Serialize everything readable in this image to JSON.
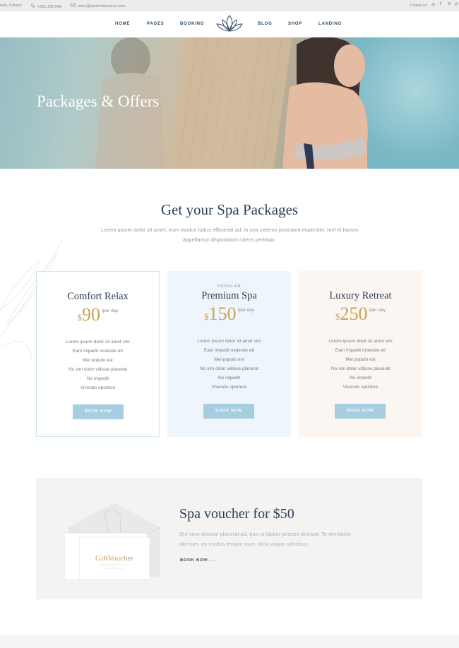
{
  "topbar": {
    "location": "avik, Iceland",
    "phone": "+351 258 548",
    "email": "reina@qodeinteractive.com",
    "follow_label": "Follow us:",
    "social_icons": [
      "instagram-icon",
      "facebook-icon",
      "pinterest-icon",
      "pinterest-icon"
    ],
    "social_glyphs": [
      "◎",
      "f",
      "℗",
      "p"
    ]
  },
  "nav": {
    "items": [
      "HOME",
      "PAGES",
      "BOOKING",
      "BLOG",
      "SHOP",
      "LANDING"
    ]
  },
  "hero": {
    "title": "Packages & Offers"
  },
  "packages": {
    "title": "Get your Spa Packages",
    "description": "Lorem ipsum dolor sit amet, eum modus ludus efficiendi ad, in sea ceteros postulant imperdiet, mel ei harum appellantur disputationi ridens pertinax.",
    "cards": [
      {
        "tag": "",
        "name": "Comfort Relax",
        "currency": "$",
        "amount": "90",
        "period": "/per day",
        "features": [
          "Lorem ipsum dolor sit amet vim",
          "Eam impedit molestie ett",
          "Mei populo est",
          "No vim dolor vidisse placerat",
          "No impedit",
          "Vivendo oportere"
        ],
        "button": "BOOK NOW"
      },
      {
        "tag": "POPULAR",
        "name": "Premium Spa",
        "currency": "$",
        "amount": "150",
        "period": "/per day",
        "features": [
          "Lorem ipsum dolor sit amet vim",
          "Eam impedit molestie ett",
          "Mei populo est",
          "No vim dolor vidisse placerat",
          "No impedit",
          "Vivendo oportere"
        ],
        "button": "BOOK NOW"
      },
      {
        "tag": "",
        "name": "Luxury Retreat",
        "currency": "$",
        "amount": "250",
        "period": "/per day",
        "features": [
          "Lorem ipsum dolor sit amet vim",
          "Eam impedit molestie ett",
          "Mei populo est",
          "No vim dolor vidisse placerat",
          "No impedit",
          "Vivendo oportere"
        ],
        "button": "BOOK NOW"
      }
    ]
  },
  "voucher": {
    "title": "Spa voucher for $50",
    "description": "Qui vero discere placerat ad, quo ut labitur percipit detraxit. Te vim latine alienum, eu modus tempor eum, dicta vitupe ratoribus.",
    "link": "BOOK NOW",
    "card_text": "GiftVoucher"
  },
  "colors": {
    "accent_gold": "#c9a25c",
    "button_blue": "#a7cde0",
    "heading_navy": "#2e3f55"
  }
}
